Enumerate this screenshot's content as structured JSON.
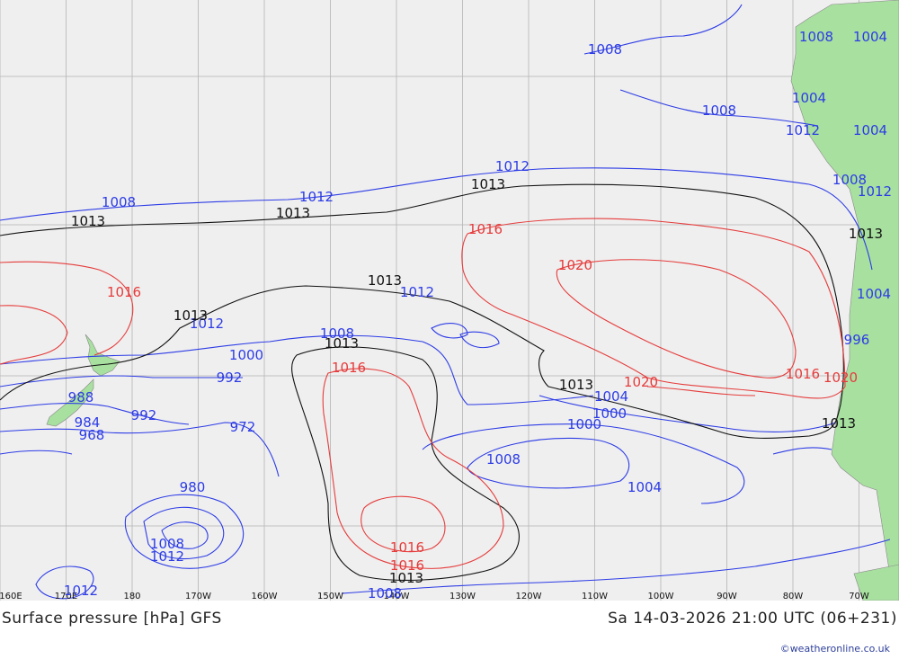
{
  "map": {
    "colors": {
      "ocean": "#efefef",
      "land": "#a8e0a0",
      "grid": "#b3b3b3",
      "low": "#2d3ce6",
      "reference": "#111111",
      "high": "#e63c3c"
    },
    "lon_ticks": [
      "160E",
      "170E",
      "180",
      "170W",
      "160W",
      "150W",
      "140W",
      "130W",
      "120W",
      "110W",
      "100W",
      "90W",
      "80W",
      "70W"
    ],
    "isobar_labels": {
      "blue": [
        "1008",
        "1008",
        "1004",
        "1008",
        "1004",
        "1012",
        "1004",
        "1008",
        "1012",
        "1012",
        "1012",
        "1008",
        "1012",
        "1012",
        "1008",
        "1004",
        "996",
        "1000",
        "992",
        "988",
        "992",
        "984",
        "968",
        "972",
        "980",
        "1008",
        "1012",
        "1012",
        "1008",
        "1004",
        "1000",
        "1000",
        "1008",
        "1004"
      ],
      "black": [
        "1013",
        "1013",
        "1013",
        "1013",
        "1013",
        "1013",
        "1013",
        "1013",
        "1013",
        "1013"
      ],
      "red": [
        "1016",
        "1020",
        "1016",
        "1016",
        "1020",
        "1016",
        "1020",
        "1016",
        "1016"
      ]
    }
  },
  "footer": {
    "title": "Surface pressure [hPa] GFS",
    "time": "Sa 14-03-2026 21:00 UTC (06+231)",
    "credit": "©weatheronline.co.uk"
  }
}
